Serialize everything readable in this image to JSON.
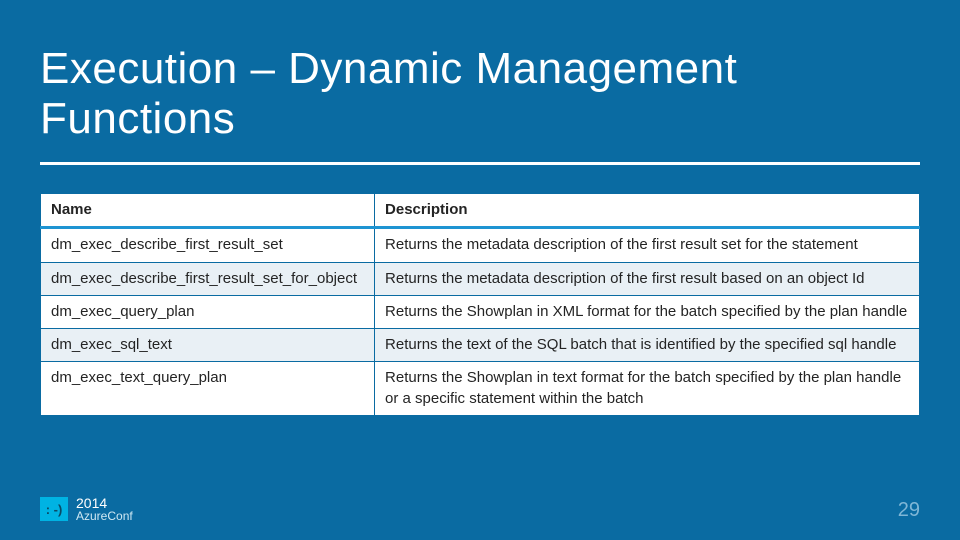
{
  "title": "Execution – Dynamic Management Functions",
  "table": {
    "headers": {
      "name": "Name",
      "desc": "Description"
    },
    "rows": [
      {
        "name": "dm_exec_describe_first_result_set",
        "desc": "Returns the metadata description of the first result set for the statement"
      },
      {
        "name": "dm_exec_describe_first_result_set_for_object",
        "desc": "Returns the metadata description of the first result based on an object Id"
      },
      {
        "name": "dm_exec_query_plan",
        "desc": "Returns the Showplan in XML format for the batch specified by the plan handle"
      },
      {
        "name": "dm_exec_sql_text",
        "desc": "Returns the text of the SQL batch that is identified by the specified sql handle"
      },
      {
        "name": "dm_exec_text_query_plan",
        "desc": "Returns the Showplan in text format for the batch specified by the plan handle or a specific statement within the batch"
      }
    ]
  },
  "footer": {
    "badge": ": -)",
    "year": "2014",
    "conf": "AzureConf"
  },
  "page_number": "29"
}
